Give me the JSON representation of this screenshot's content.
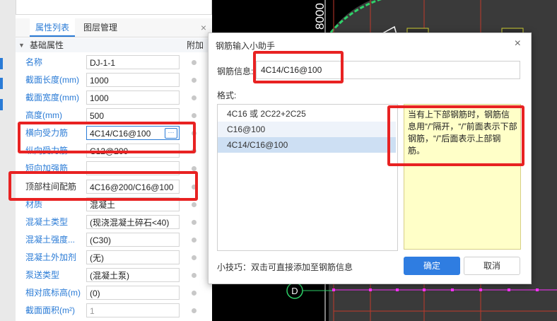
{
  "property_panel": {
    "tabs": [
      "属性列表",
      "图层管理"
    ],
    "close_glyph": "×",
    "group": {
      "title": "基础属性",
      "extra_col": "附加"
    },
    "rows": [
      {
        "label": "名称",
        "value": "DJ-1-1"
      },
      {
        "label": "截面长度(mm)",
        "value": "1000"
      },
      {
        "label": "截面宽度(mm)",
        "value": "1000"
      },
      {
        "label": "高度(mm)",
        "value": "500"
      },
      {
        "label": "横向受力筋",
        "value": "4C14/C16@100"
      },
      {
        "label": "纵向受力筋",
        "value": "C12@200"
      },
      {
        "label": "短向加强筋",
        "value": ""
      },
      {
        "label": "顶部柱间配筋",
        "value": "4C16@200/C16@100"
      },
      {
        "label": "材质",
        "value": "混凝土"
      },
      {
        "label": "混凝土类型",
        "value": "(现浇混凝土碎石<40)"
      },
      {
        "label": "混凝土强度...",
        "value": "(C30)"
      },
      {
        "label": "混凝土外加剂",
        "value": "(无)"
      },
      {
        "label": "泵送类型",
        "value": "(混凝土泵)"
      },
      {
        "label": "相对底标高(m)",
        "value": "(0)"
      },
      {
        "label": "截面面积(m²)",
        "value": "1"
      }
    ],
    "more_button": "···"
  },
  "dialog": {
    "title": "钢筋输入小助手",
    "close_glyph": "×",
    "info_label": "钢筋信息:",
    "info_value": "4C14/C16@100",
    "format_label": "格式:",
    "format_items": [
      "4C16 或 2C22+2C25",
      "C16@100",
      "4C14/C16@100"
    ],
    "tip_text": "当有上下部钢筋时，钢筋信息用“/”隔开，“/”前面表示下部钢筋，“/”后面表示上部钢筋。",
    "hint": "小技巧：双击可直接添加至钢筋信息",
    "ok_label": "确定",
    "cancel_label": "取消"
  },
  "canvas": {
    "dim_text": "8000",
    "axis_label": "D"
  },
  "colors": {
    "accent": "#2a7bd6",
    "highlight": "#e82222",
    "tip_bg": "#ffffc8",
    "grid_green": "#2fd36a",
    "grid_magenta": "#ff33ff",
    "grid_red": "#c0392b"
  }
}
